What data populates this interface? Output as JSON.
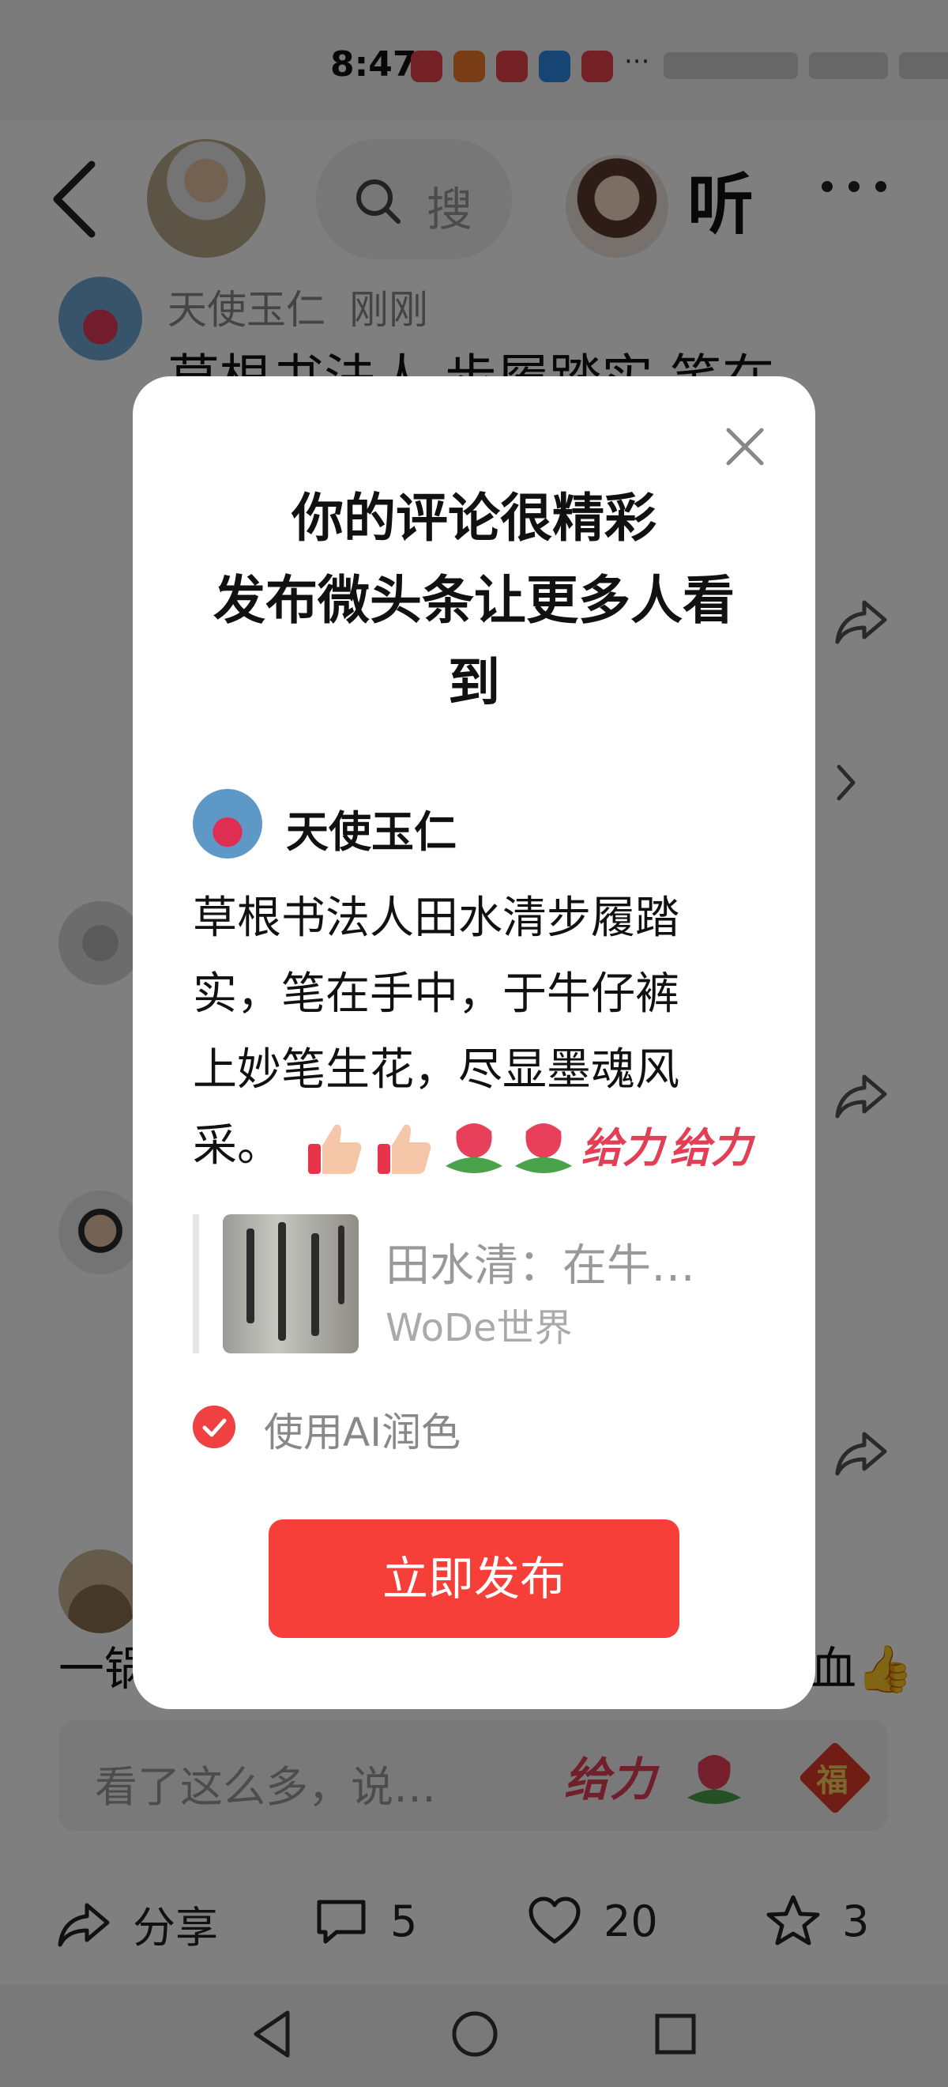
{
  "status_bar": {
    "time": "8:47",
    "more": "···"
  },
  "header": {
    "search_hint": "搜",
    "listen_label": "听"
  },
  "comment": {
    "author": "天使玉仁",
    "time": "刚刚",
    "text": "草根书法人  步履踏实  笔在"
  },
  "background": {
    "left_fragment": "一锅",
    "right_fragment": "血👍"
  },
  "input": {
    "placeholder": "看了这么多，说…",
    "sticker_geili": "给力",
    "sticker_fu": "福"
  },
  "actions": {
    "share_label": "分享",
    "comments_count": "5",
    "likes_count": "20",
    "favorites_count": "3"
  },
  "modal": {
    "title_line1": "你的评论很精彩",
    "title_line2": "发布微头条让更多人看",
    "title_line3": "到",
    "author": "天使玉仁",
    "body_line1": "草根书法人田水清步履踏",
    "body_line2": "实，笔在手中，于牛仔裤",
    "body_line3": "上妙笔生花，尽显墨魂风",
    "body_line4": "采。",
    "emoji_geili_1": "给力",
    "emoji_geili_2": "给力",
    "quote_title": "田水清：在牛…",
    "quote_source": "WoDe世界",
    "ai_label": "使用AI润色",
    "ai_checked": true,
    "publish_label": "立即发布"
  },
  "colors": {
    "accent": "#f73f3a",
    "check": "#f04142",
    "scrim": "rgba(0,0,0,0.5)"
  }
}
